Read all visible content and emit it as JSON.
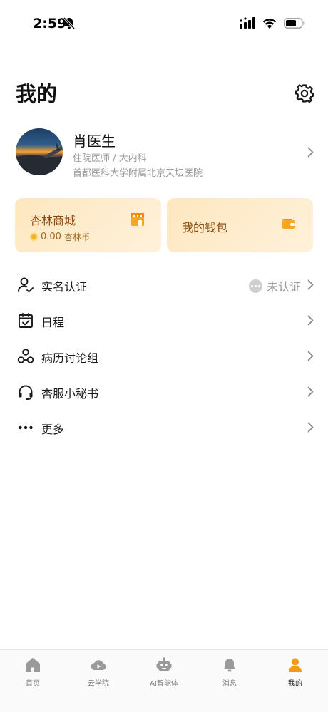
{
  "status_bar": {
    "time": "2:59"
  },
  "header": {
    "title": "我的"
  },
  "profile": {
    "name": "肖医生",
    "title": "住院医师 / 大内科",
    "hospital": "首都医科大学附属北京天坛医院"
  },
  "cards": {
    "mall": {
      "title": "杏林商城",
      "coin_amount": "0.00",
      "coin_unit": "杏林币"
    },
    "wallet": {
      "title": "我的钱包"
    }
  },
  "menu": [
    {
      "label": "实名认证",
      "icon": "user-verify-icon",
      "status": "未认证"
    },
    {
      "label": "日程",
      "icon": "calendar-check-icon"
    },
    {
      "label": "病历讨论组",
      "icon": "group-nodes-icon"
    },
    {
      "label": "杏服小秘书",
      "icon": "headset-icon"
    },
    {
      "label": "更多",
      "icon": "more-dots-icon"
    }
  ],
  "tabbar": [
    {
      "label": "首页",
      "icon": "home-icon"
    },
    {
      "label": "云学院",
      "icon": "cloud-play-icon"
    },
    {
      "label": "AI智能体",
      "icon": "robot-icon"
    },
    {
      "label": "消息",
      "icon": "bell-icon"
    },
    {
      "label": "我的",
      "icon": "person-icon",
      "active": true
    }
  ],
  "colors": {
    "accent": "#f39a1c",
    "card_text": "#8a4a0d",
    "card_bg": "#fde7bf",
    "muted_text": "#9a9a9a"
  }
}
